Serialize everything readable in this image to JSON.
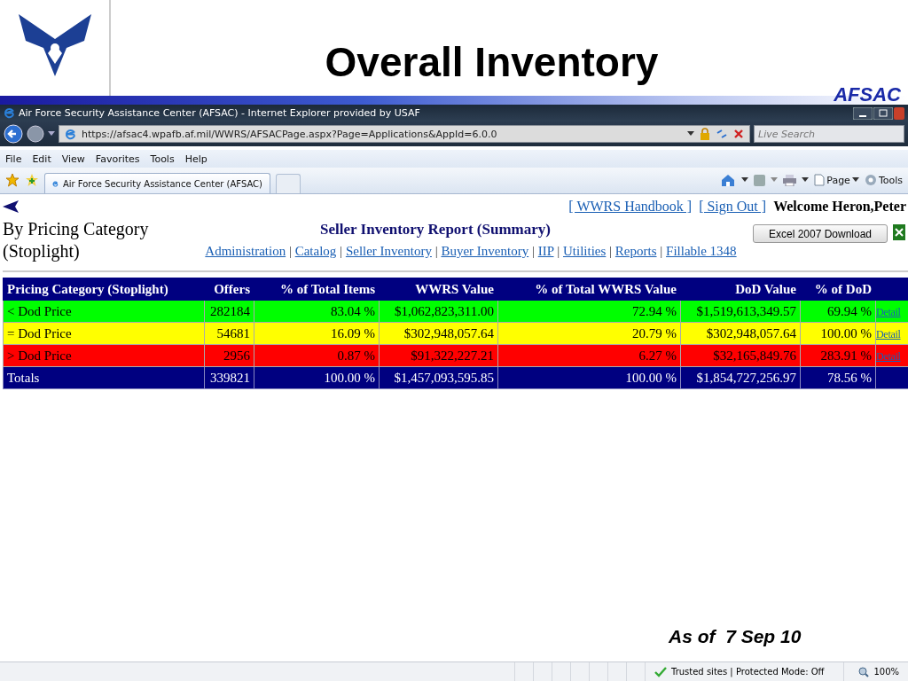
{
  "slide": {
    "title": "Overall Inventory",
    "brand": "AFSAC",
    "footer": "As of  7 Sep 10"
  },
  "browser": {
    "title": "Air Force Security Assistance Center (AFSAC) - Internet Explorer provided by USAF",
    "url": "https://afsac4.wpafb.af.mil/WWRS/AFSACPage.aspx?Page=Applications&AppId=6.0.0",
    "search": {
      "placeholder": "Live Search"
    },
    "menu": [
      "File",
      "Edit",
      "View",
      "Favorites",
      "Tools",
      "Help"
    ],
    "tabs": [
      {
        "label": "Air Force Security Assistance Center (AFSAC)",
        "selected": true
      }
    ],
    "command_bar": [
      "Page",
      "Tools"
    ]
  },
  "page": {
    "top_links": [
      "[ WWRS Handbook ]",
      "[ Sign Out ]"
    ],
    "welcome": "Welcome Heron,Peter",
    "subtitle": "By Pricing Category (Stoplight)",
    "report_title": "Seller Inventory Report (Summary)",
    "download_button": "Excel 2007 Download",
    "nav_separator": "|",
    "nav_links": [
      "Administration",
      "Catalog",
      "Seller Inventory",
      "Buyer Inventory",
      "IIP",
      "Utilities",
      "Reports",
      "Fillable 1348"
    ],
    "table": {
      "columns": [
        "Pricing Category (Stoplight)",
        "Offers",
        "% of Total Items",
        "WWRS Value",
        "% of Total WWRS Value",
        "DoD Value",
        "% of DoD"
      ],
      "rows": [
        {
          "cells": [
            "< Dod Price",
            "282184",
            "83.04 %",
            "$1,062,823,311.00",
            "72.94 %",
            "$1,519,613,349.57",
            "69.94 %"
          ],
          "link": "Detail",
          "color": "#00ff00"
        },
        {
          "cells": [
            "= Dod Price",
            "54681",
            "16.09 %",
            "$302,948,057.64",
            "20.79 %",
            "$302,948,057.64",
            "100.00 %"
          ],
          "link": "Detail",
          "color": "#ffff00"
        },
        {
          "cells": [
            "> Dod Price",
            "2956",
            "0.87 %",
            "$91,322,227.21",
            "6.27 %",
            "$32,165,849.76",
            "283.91 %"
          ],
          "link": "Detail",
          "color": "#ff0000"
        }
      ],
      "totals": [
        "Totals",
        "339821",
        "100.00 %",
        "$1,457,093,595.85",
        "100.00 %",
        "$1,854,727,256.97",
        "78.56 %"
      ]
    }
  },
  "status_bar": {
    "zone": "Trusted sites | Protected Mode: Off",
    "zoom": "100%"
  }
}
